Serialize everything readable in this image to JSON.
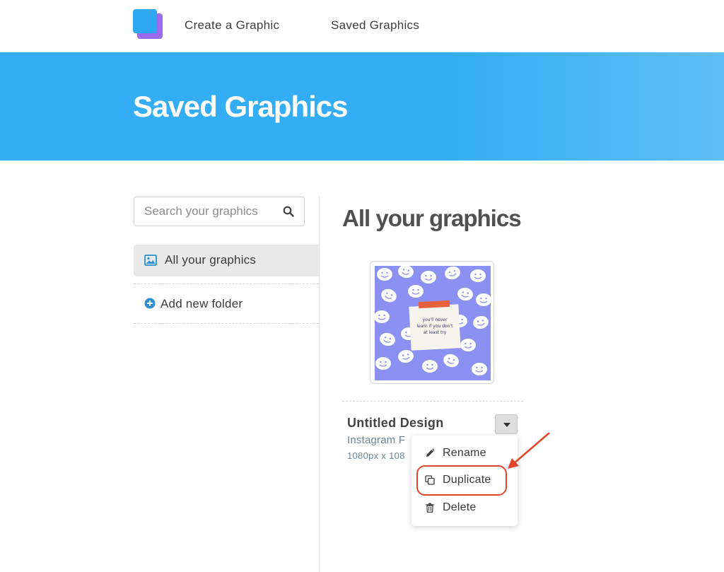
{
  "nav": {
    "create_label": "Create a Graphic",
    "saved_label": "Saved Graphics"
  },
  "banner": {
    "title": "Saved Graphics"
  },
  "sidebar": {
    "search_placeholder": "Search your graphics",
    "items": [
      {
        "label": "All your graphics",
        "icon": "image-icon",
        "active": true
      },
      {
        "label": "Add new folder",
        "icon": "plus-circle-icon"
      }
    ]
  },
  "main": {
    "title": "All your graphics",
    "card": {
      "thumbnail_text": "you'll never learn if you don't at least try",
      "name": "Untitled Design",
      "type": "Instagram F",
      "size": "1080px x 108"
    },
    "menu": {
      "items": [
        {
          "label": "Rename",
          "icon": "pencil-icon"
        },
        {
          "label": "Duplicate",
          "icon": "copy-icon",
          "highlighted": true
        },
        {
          "label": "Delete",
          "icon": "trash-icon"
        }
      ]
    }
  },
  "colors": {
    "brand_blue": "#33adf3",
    "logo_purple": "#9b6cf0",
    "highlight_red": "#e2452b",
    "thumbnail_purple": "#8b91f2"
  }
}
